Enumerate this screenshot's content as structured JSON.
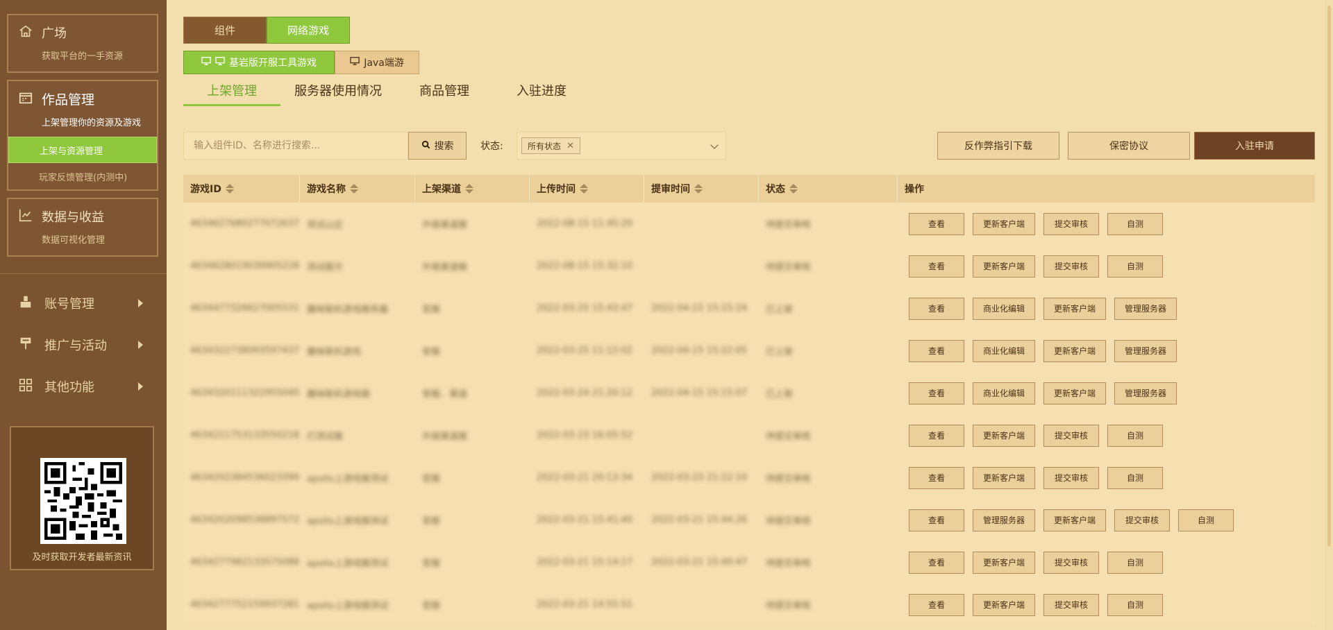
{
  "sidebar": {
    "square": {
      "title": "广场",
      "sub": "获取平台的一手资源"
    },
    "works": {
      "title": "作品管理",
      "sub": "上架管理你的资源及游戏",
      "items": [
        {
          "label": "上架与资源管理"
        },
        {
          "label": "玩家反馈管理(内测中)"
        }
      ]
    },
    "data": {
      "title": "数据与收益",
      "sub": "数据可视化管理"
    },
    "menus": [
      {
        "label": "账号管理"
      },
      {
        "label": "推广与活动"
      },
      {
        "label": "其他功能"
      }
    ],
    "qr_caption": "及时获取开发者最新资讯"
  },
  "top_seg": {
    "components": "组件",
    "online_games": "网络游戏"
  },
  "sub_seg": {
    "bedrock": "基岩版开服工具游戏",
    "java": "Java端游"
  },
  "tabs": [
    {
      "label": "上架管理"
    },
    {
      "label": "服务器使用情况"
    },
    {
      "label": "商品管理"
    },
    {
      "label": "入驻进度"
    }
  ],
  "toolbar": {
    "search_placeholder": "输入组件ID、名称进行搜索...",
    "search_label": "搜索",
    "status_label": "状态:",
    "status_tag": "所有状态",
    "anticheat_label": "反作弊指引下载",
    "nda_label": "保密协议",
    "apply_label": "入驻申请"
  },
  "table": {
    "headers": [
      "游戏ID",
      "游戏名称",
      "上架渠道",
      "上传时间",
      "提审时间",
      "状态",
      "操作"
    ],
    "rows": [
      {
        "id": "4634627680277072637",
        "name": "测试山庄",
        "channel": "外链渠道服",
        "upload": "2022-08-15 11:45:20",
        "submit": "",
        "status": "待提交审核",
        "ops": [
          "查看",
          "更新客户端",
          "提交审核",
          "自测"
        ]
      },
      {
        "id": "4634628019039905228",
        "name": "测试服方",
        "channel": "外链渠道服",
        "upload": "2022-08-15 15:32:10",
        "submit": "",
        "status": "待提交审核",
        "ops": [
          "查看",
          "更新客户端",
          "提交审核",
          "自测"
        ]
      },
      {
        "id": "4634477326627005531",
        "name": "趣味联机游戏服务器",
        "channel": "官服",
        "upload": "2022-03-25 15:43:47",
        "submit": "2022-04-15 15:15:24",
        "status": "已上架",
        "ops": [
          "查看",
          "商业化编辑",
          "更新客户端",
          "管理服务器"
        ]
      },
      {
        "id": "4634322738093597437",
        "name": "趣味联机游戏",
        "channel": "官服",
        "upload": "2022-03-25 11:12:02",
        "submit": "2022-04-15 15:22:05",
        "status": "已上架",
        "ops": [
          "查看",
          "商业化编辑",
          "更新客户端",
          "管理服务器"
        ]
      },
      {
        "id": "4634320111322955040",
        "name": "趣味联机游戏服",
        "channel": "官服、渠道",
        "upload": "2022-03-24 21:20:12",
        "submit": "2022-04-15 15:15:07",
        "status": "已上架",
        "ops": [
          "查看",
          "商业化编辑",
          "更新客户端",
          "管理服务器"
        ]
      },
      {
        "id": "4634221753133550218",
        "name": "打测试服",
        "channel": "外链渠道服",
        "upload": "2022-03-23 16:05:52",
        "submit": "",
        "status": "待提交审核",
        "ops": [
          "查看",
          "更新客户端",
          "提交审核",
          "自测"
        ]
      },
      {
        "id": "4634202384536023399",
        "name": "apollo上游戏服测试",
        "channel": "官服",
        "upload": "2022-03-21 20:13:34",
        "submit": "2022-03-23 21:22:10",
        "status": "待提交审核",
        "ops": [
          "查看",
          "更新客户端",
          "提交审核",
          "自测"
        ]
      },
      {
        "id": "4634202098538897572",
        "name": "apollo上游戏服测试",
        "channel": "官服",
        "upload": "2022-03-21 15:41:40",
        "submit": "2022-03-21 15:44:26",
        "status": "待提交审核",
        "ops": [
          "查看",
          "管理服务器",
          "更新客户端",
          "提交审核",
          "自测"
        ]
      },
      {
        "id": "4634277982133575088",
        "name": "apollo上游戏服测试",
        "channel": "官服",
        "upload": "2022-03-21 15:14:17",
        "submit": "2022-03-21 15:40:47",
        "status": "待提交审核",
        "ops": [
          "查看",
          "更新客户端",
          "提交审核",
          "自测"
        ]
      },
      {
        "id": "4634277752159937281",
        "name": "apollo上游戏服测试",
        "channel": "官服",
        "upload": "2022-03-21 14:55:51",
        "submit": "",
        "status": "待提交审核",
        "ops": [
          "查看",
          "更新客户端",
          "提交审核",
          "自测"
        ]
      }
    ]
  },
  "colors": {
    "accent_green": "#8fc83d",
    "sidebar_bg": "#7a5331",
    "page_bg": "#f3dfae",
    "apply_btn": "#6e4325"
  }
}
